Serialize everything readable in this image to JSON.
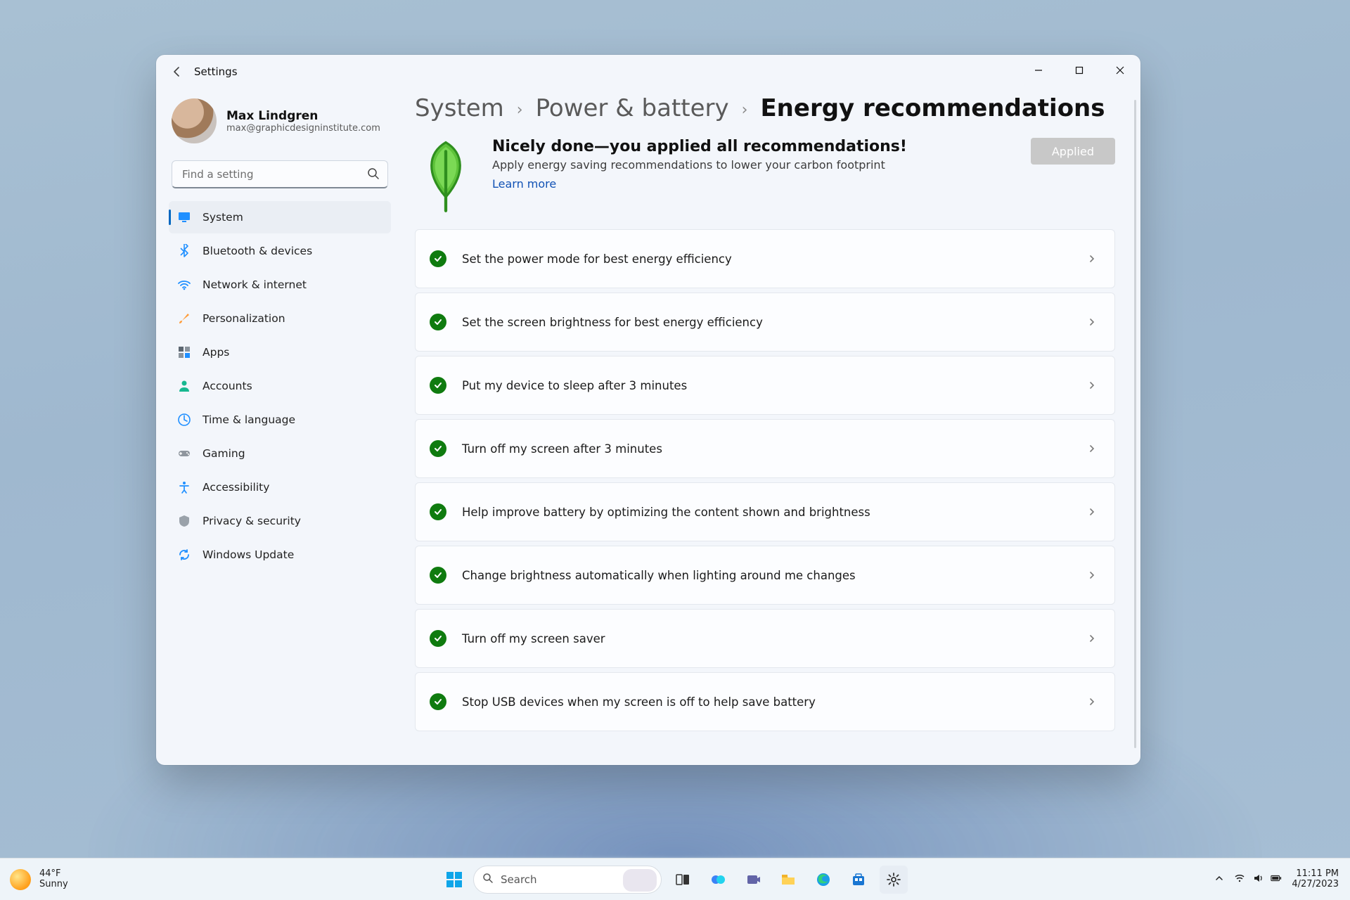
{
  "window": {
    "title": "Settings"
  },
  "profile": {
    "name": "Max Lindgren",
    "email": "max@graphicdesigninstitute.com"
  },
  "search": {
    "placeholder": "Find a setting"
  },
  "sidebar": {
    "items": [
      {
        "label": "System"
      },
      {
        "label": "Bluetooth & devices"
      },
      {
        "label": "Network & internet"
      },
      {
        "label": "Personalization"
      },
      {
        "label": "Apps"
      },
      {
        "label": "Accounts"
      },
      {
        "label": "Time & language"
      },
      {
        "label": "Gaming"
      },
      {
        "label": "Accessibility"
      },
      {
        "label": "Privacy & security"
      },
      {
        "label": "Windows Update"
      }
    ]
  },
  "breadcrumb": {
    "parent1": "System",
    "parent2": "Power & battery",
    "current": "Energy recommendations"
  },
  "banner": {
    "headline": "Nicely done—you applied all recommendations!",
    "subtext": "Apply energy saving recommendations to lower your carbon footprint",
    "learn_more": "Learn more",
    "applied_button": "Applied"
  },
  "recommendations": [
    {
      "label": "Set the power mode for best energy efficiency"
    },
    {
      "label": "Set the screen brightness for best energy efficiency"
    },
    {
      "label": "Put my device to sleep after 3 minutes"
    },
    {
      "label": "Turn off my screen after 3 minutes"
    },
    {
      "label": "Help improve battery by optimizing the content shown and brightness"
    },
    {
      "label": "Change brightness automatically when lighting around me changes"
    },
    {
      "label": "Turn off my screen saver"
    },
    {
      "label": "Stop USB devices when my screen is off to help save battery"
    }
  ],
  "taskbar": {
    "weather_temp": "44°F",
    "weather_cond": "Sunny",
    "search_placeholder": "Search",
    "time": "11:11 PM",
    "date": "4/27/2023"
  },
  "colors": {
    "accent": "#0067c0",
    "success": "#0f7b0f"
  }
}
